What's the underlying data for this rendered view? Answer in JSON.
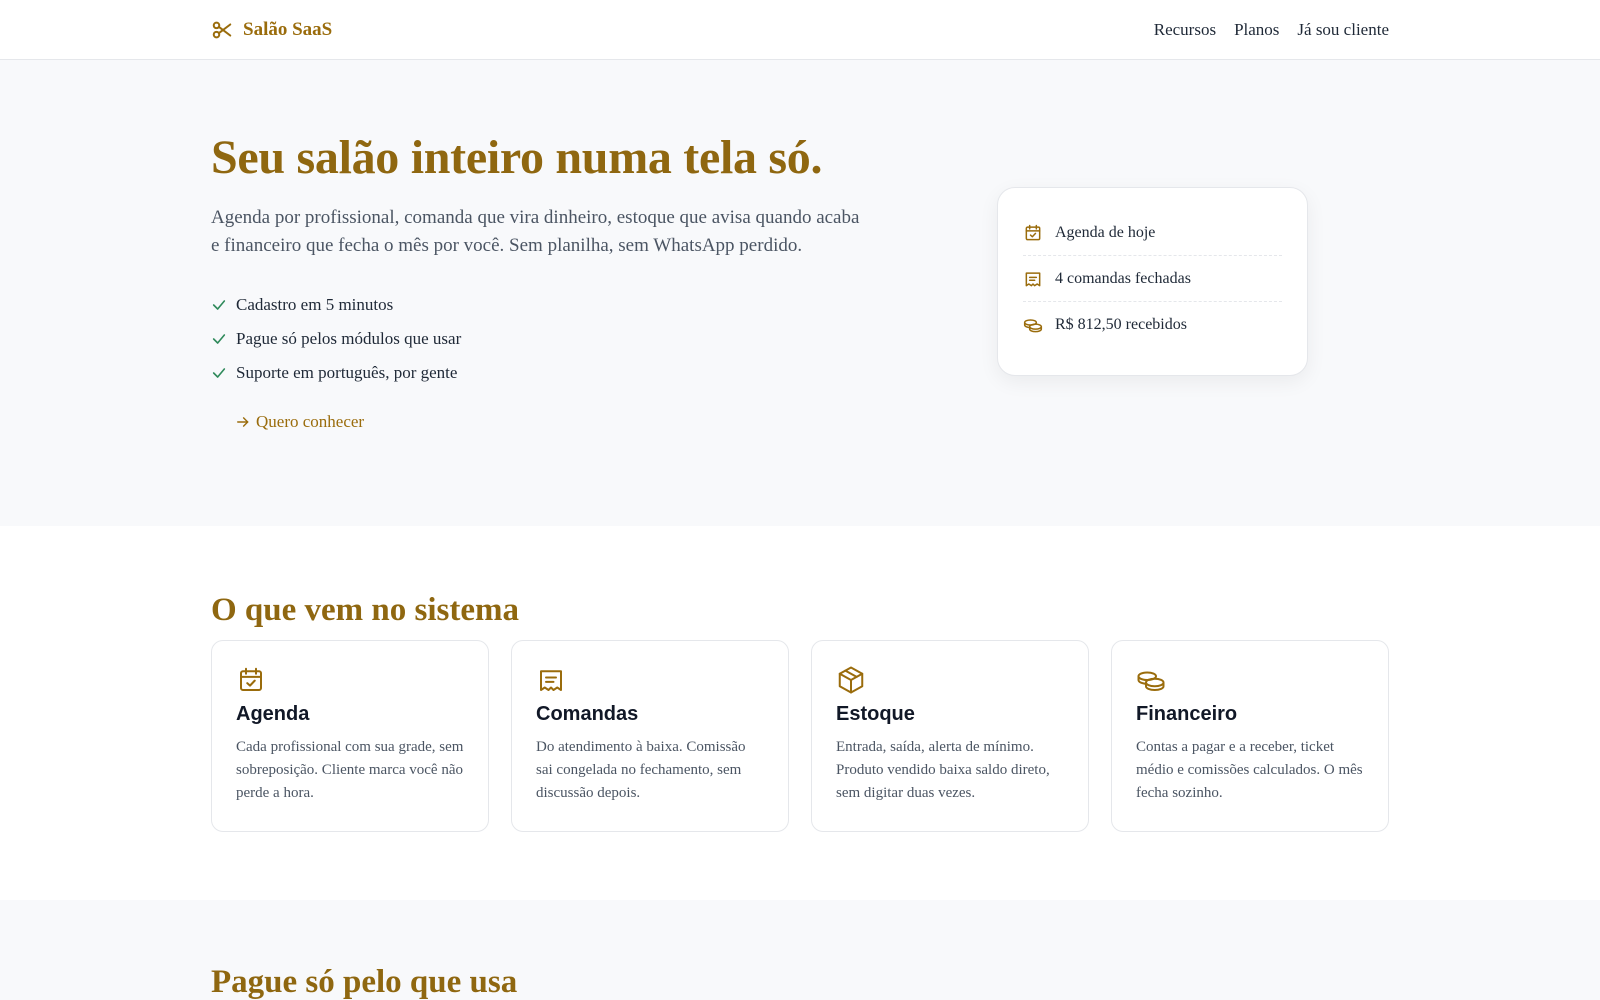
{
  "brand": {
    "name": "Salão SaaS",
    "icon": "scissors-icon"
  },
  "nav": {
    "items": [
      "Recursos",
      "Planos",
      "Já sou cliente"
    ]
  },
  "hero": {
    "title": "Seu salão inteiro numa tela só.",
    "lead": "Agenda por profissional, comanda que vira dinheiro, estoque que avisa quando acaba e financeiro que fecha o mês por você. Sem planilha, sem WhatsApp perdido.",
    "checks": [
      "Cadastro em 5 minutos",
      "Pague só pelos módulos que usar",
      "Suporte em português, por gente"
    ],
    "cta": "Quero conhecer"
  },
  "today_card": {
    "rows": [
      {
        "icon": "calendar-check-icon",
        "text": "Agenda de hoje"
      },
      {
        "icon": "receipt-icon",
        "text": "4 comandas fechadas"
      },
      {
        "icon": "coins-icon",
        "text": "R$ 812,50 recebidos"
      }
    ]
  },
  "features": {
    "title": "O que vem no sistema",
    "cards": [
      {
        "icon": "calendar-check-icon",
        "title": "Agenda",
        "text": "Cada profissional com sua grade, sem sobreposição. Cliente marca você não perde a hora."
      },
      {
        "icon": "receipt-icon",
        "title": "Comandas",
        "text": "Do atendimento à baixa. Comissão sai congelada no fechamento, sem discussão depois."
      },
      {
        "icon": "box-icon",
        "title": "Estoque",
        "text": "Entrada, saída, alerta de mínimo. Produto vendido baixa saldo direto, sem digitar duas vezes."
      },
      {
        "icon": "coins-icon",
        "title": "Financeiro",
        "text": "Contas a pagar e a receber, ticket médio e comissões calculados. O mês fecha sozinho."
      }
    ]
  },
  "pricing": {
    "title": "Pague só pelo que usa"
  },
  "colors": {
    "accent": "#9a6c0c",
    "heading": "#8f6710",
    "check": "#2f8a5b",
    "hero_bg": "#f8f9fb"
  }
}
